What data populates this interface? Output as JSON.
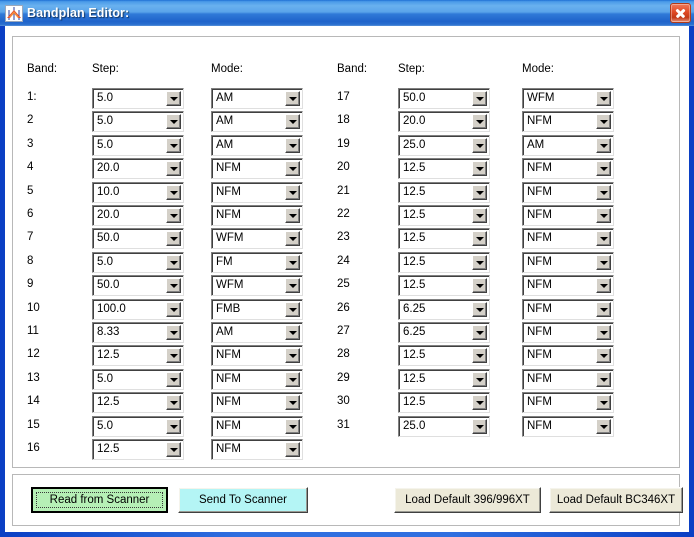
{
  "window": {
    "title": "Bandplan Editor:",
    "icon": "antenna-icon",
    "close_label": "×",
    "titlebar_color": "#2f79d8",
    "close_color": "#e04a26"
  },
  "headers": {
    "band": "Band:",
    "step": "Step:",
    "mode": "Mode:"
  },
  "rows_left": [
    {
      "band": "1:",
      "step": "5.0",
      "mode": "AM"
    },
    {
      "band": "2",
      "step": "5.0",
      "mode": "AM"
    },
    {
      "band": "3",
      "step": "5.0",
      "mode": "AM"
    },
    {
      "band": "4",
      "step": "20.0",
      "mode": "NFM"
    },
    {
      "band": "5",
      "step": "10.0",
      "mode": "NFM"
    },
    {
      "band": "6",
      "step": "20.0",
      "mode": "NFM"
    },
    {
      "band": "7",
      "step": "50.0",
      "mode": "WFM"
    },
    {
      "band": "8",
      "step": "5.0",
      "mode": "FM"
    },
    {
      "band": "9",
      "step": "50.0",
      "mode": "WFM"
    },
    {
      "band": "10",
      "step": "100.0",
      "mode": "FMB"
    },
    {
      "band": "11",
      "step": "8.33",
      "mode": "AM"
    },
    {
      "band": "12",
      "step": "12.5",
      "mode": "NFM"
    },
    {
      "band": "13",
      "step": "5.0",
      "mode": "NFM"
    },
    {
      "band": "14",
      "step": "12.5",
      "mode": "NFM"
    },
    {
      "band": "15",
      "step": "5.0",
      "mode": "NFM"
    },
    {
      "band": "16",
      "step": "12.5",
      "mode": "NFM"
    }
  ],
  "rows_right": [
    {
      "band": "17",
      "step": "50.0",
      "mode": "WFM"
    },
    {
      "band": "18",
      "step": "20.0",
      "mode": "NFM"
    },
    {
      "band": "19",
      "step": "25.0",
      "mode": "AM"
    },
    {
      "band": "20",
      "step": "12.5",
      "mode": "NFM"
    },
    {
      "band": "21",
      "step": "12.5",
      "mode": "NFM"
    },
    {
      "band": "22",
      "step": "12.5",
      "mode": "NFM"
    },
    {
      "band": "23",
      "step": "12.5",
      "mode": "NFM"
    },
    {
      "band": "24",
      "step": "12.5",
      "mode": "NFM"
    },
    {
      "band": "25",
      "step": "12.5",
      "mode": "NFM"
    },
    {
      "band": "26",
      "step": "6.25",
      "mode": "NFM"
    },
    {
      "band": "27",
      "step": "6.25",
      "mode": "NFM"
    },
    {
      "band": "28",
      "step": "12.5",
      "mode": "NFM"
    },
    {
      "band": "29",
      "step": "12.5",
      "mode": "NFM"
    },
    {
      "band": "30",
      "step": "12.5",
      "mode": "NFM"
    },
    {
      "band": "31",
      "step": "25.0",
      "mode": "NFM"
    }
  ],
  "buttons": {
    "read_from_scanner": {
      "label": "Read from Scanner",
      "color": "#b6f0b6",
      "focused": true
    },
    "send_to_scanner": {
      "label": "Send To Scanner",
      "color": "#b4f5f5",
      "focused": false
    },
    "load_default_396": {
      "label": "Load Default 396/996XT",
      "color": "#ece9d8",
      "focused": false
    },
    "load_default_346": {
      "label": "Load Default BC346XT",
      "color": "#ece9d8",
      "focused": false
    }
  }
}
